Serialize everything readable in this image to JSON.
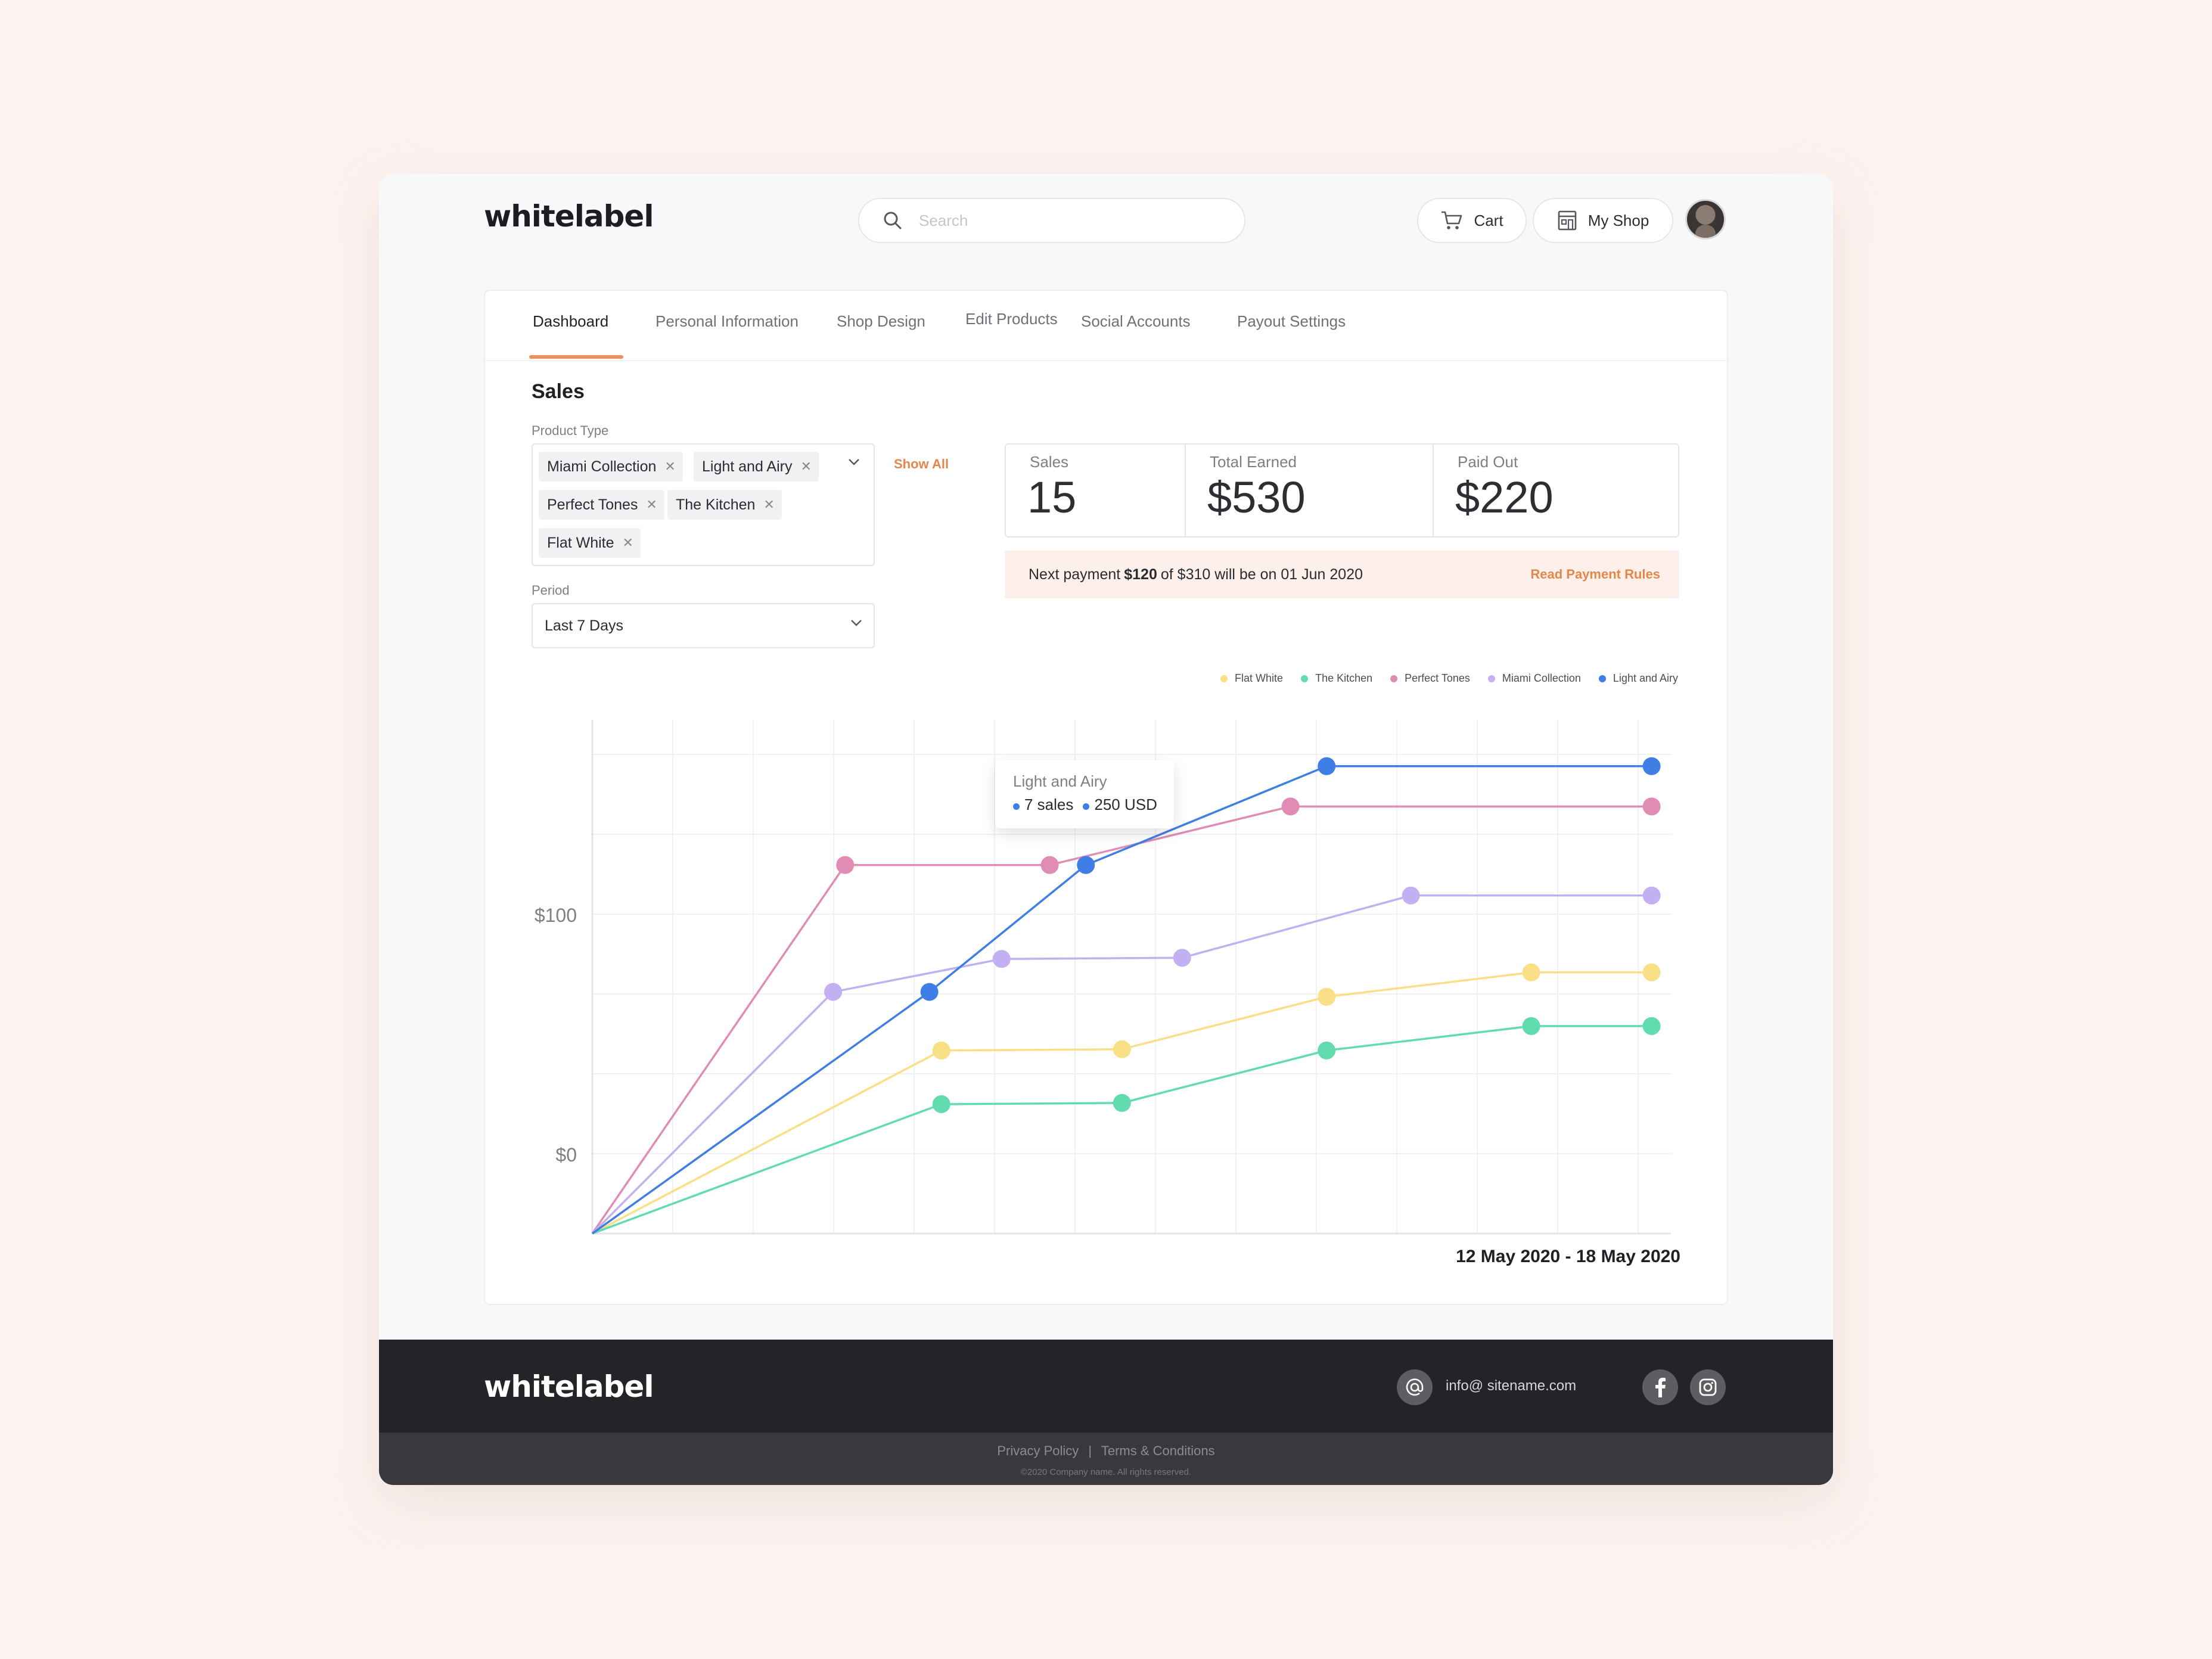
{
  "app": {
    "brand": "whitelabel"
  },
  "header": {
    "search_placeholder": "Search",
    "cart_label": "Cart",
    "shop_label": "My Shop"
  },
  "tabs": [
    {
      "label": "Dashboard",
      "active": true
    },
    {
      "label": "Personal Information",
      "active": false
    },
    {
      "label": "Shop Design",
      "active": false
    },
    {
      "label": "Edit Products",
      "active": false
    },
    {
      "label": "Social Accounts",
      "active": false
    },
    {
      "label": "Payout Settings",
      "active": false
    }
  ],
  "sales": {
    "heading": "Sales",
    "product_type_label": "Product Type",
    "selected_products": [
      "Miami Collection",
      "Light and Airy",
      "Perfect Tones",
      "The Kitchen",
      "Flat White"
    ],
    "show_all": "Show All",
    "period_label": "Period",
    "period_value": "Last 7 Days"
  },
  "stats": [
    {
      "label": "Sales",
      "value": "15"
    },
    {
      "label": "Total Earned",
      "value": "$530"
    },
    {
      "label": "Paid Out",
      "value": "$220"
    }
  ],
  "banner": {
    "prefix": "Next payment",
    "amount": "$120",
    "suffix": "of $310 will be on 01 Jun 2020",
    "link": "Read Payment  Rules"
  },
  "tooltip": {
    "title": "Light and Airy",
    "sales": "7 sales",
    "amount": "250 USD"
  },
  "date_range": "12 May 2020 - 18 May 2020",
  "colors": {
    "accent": "#e8925a",
    "flat_white": "#f9df85",
    "the_kitchen": "#62dcae",
    "perfect_tones": "#e08cb4",
    "miami_collection": "#c2b0f2",
    "light_and_airy": "#3f7ee4"
  },
  "chart_data": {
    "type": "line",
    "title": "",
    "xlabel": "",
    "ylabel": "",
    "y_tick_labels": [
      "$0",
      "$100"
    ],
    "ylim": [
      0,
      210
    ],
    "grid": true,
    "legend_position": "top-right",
    "series": [
      {
        "name": "Flat White",
        "color": "#f9df85",
        "points": [
          [
            0,
            0
          ],
          [
            2.9,
            75
          ],
          [
            4.4,
            75.5
          ],
          [
            6.1,
            97
          ],
          [
            7.8,
            107
          ],
          [
            8.8,
            107
          ]
        ]
      },
      {
        "name": "The Kitchen",
        "color": "#62dcae",
        "points": [
          [
            0,
            0
          ],
          [
            2.9,
            53
          ],
          [
            4.4,
            53.5
          ],
          [
            6.1,
            75
          ],
          [
            7.8,
            85
          ],
          [
            8.8,
            85
          ]
        ]
      },
      {
        "name": "Perfect Tones",
        "color": "#e08cb4",
        "points": [
          [
            0,
            0
          ],
          [
            2.1,
            151
          ],
          [
            3.8,
            151
          ],
          [
            5.8,
            175
          ],
          [
            8.8,
            175
          ]
        ]
      },
      {
        "name": "Miami Collection",
        "color": "#c2b0f2",
        "points": [
          [
            0,
            0
          ],
          [
            2.0,
            99
          ],
          [
            3.4,
            112.5
          ],
          [
            4.9,
            113
          ],
          [
            6.8,
            138.5
          ],
          [
            8.8,
            138.5
          ]
        ]
      },
      {
        "name": "Light and Airy",
        "color": "#3f7ee4",
        "points": [
          [
            0,
            0
          ],
          [
            2.8,
            99
          ],
          [
            4.1,
            151
          ],
          [
            6.1,
            191.5
          ],
          [
            8.8,
            191.5
          ]
        ]
      }
    ]
  },
  "footer": {
    "email": "info@ sitename.com",
    "privacy": "Privacy Policy",
    "separator": "|",
    "terms": "Terms & Conditions",
    "copyright": "©2020 Company name. All rights reserved."
  }
}
